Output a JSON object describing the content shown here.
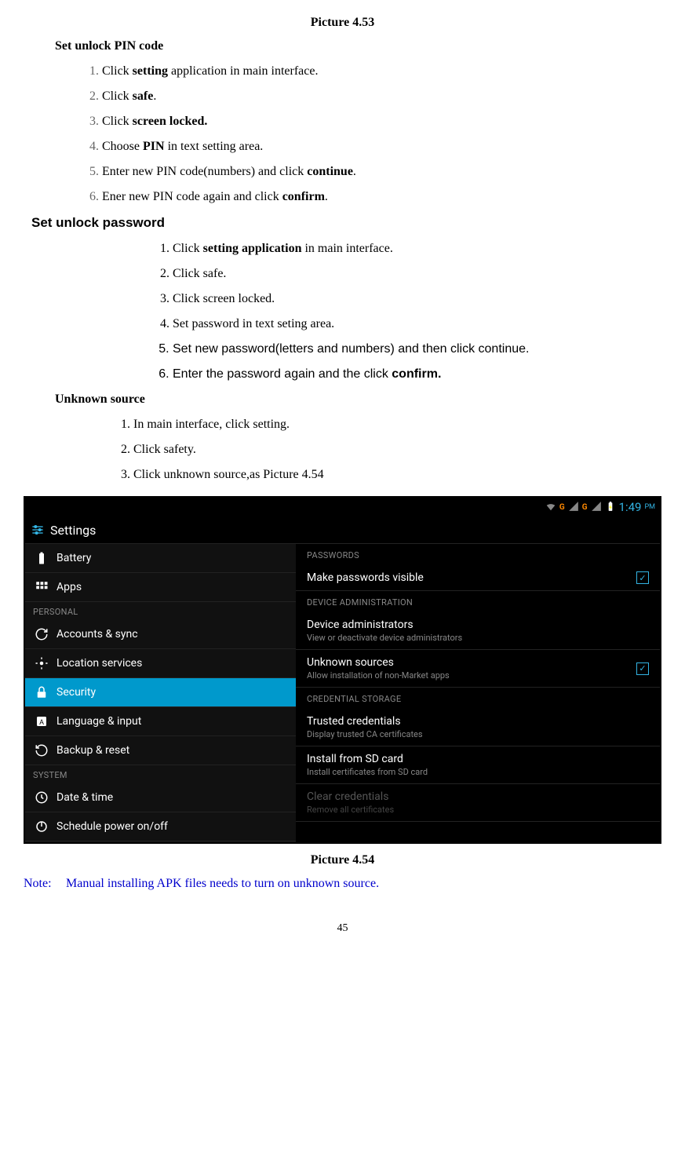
{
  "caption_top": "Picture 4.53",
  "section_pin_title": "Set unlock PIN code",
  "list_pin": [
    "Click <b>setting</b> application in main interface.",
    "Click <b>safe</b>.",
    "Click <b>screen locked.</b>",
    "Choose <b>PIN</b> in text setting area.",
    "Enter new PIN code(numbers) and click <b>continue</b>.",
    "Ener new PIN code again and click <b>confirm</b>."
  ],
  "section_password_title": "Set unlock password",
  "list_password": [
    "Click <b>setting application</b> in main interface.",
    "Click safe.",
    "Click screen locked.",
    "Set password in text seting area.",
    "Set new password(letters and numbers) and then click continue.",
    "Enter the password again and the click <b>confirm.</b>"
  ],
  "section_unknown_title": "Unknown source",
  "list_unknown": [
    "In main interface, click setting.",
    "Click safety.",
    "Click unknown source,as Picture 4.54"
  ],
  "caption_mid": "Picture 4.54",
  "note_label": "Note:",
  "note_text": "Manual installing APK files needs to turn on unknown source.",
  "page_number": "45",
  "screenshot": {
    "app_title": "Settings",
    "time": "1:49",
    "pm": "PM",
    "left": {
      "items_top": [
        {
          "icon": "battery",
          "label": "Battery"
        },
        {
          "icon": "apps",
          "label": "Apps"
        }
      ],
      "section_personal": "PERSONAL",
      "items_personal": [
        {
          "icon": "sync",
          "label": "Accounts & sync"
        },
        {
          "icon": "location",
          "label": "Location services"
        },
        {
          "icon": "lock",
          "label": "Security",
          "selected": true
        },
        {
          "icon": "lang",
          "label": "Language & input"
        },
        {
          "icon": "reset",
          "label": "Backup & reset"
        }
      ],
      "section_system": "SYSTEM",
      "items_system": [
        {
          "icon": "clock",
          "label": "Date & time"
        },
        {
          "icon": "power",
          "label": "Schedule power on/off"
        }
      ]
    },
    "right": {
      "sec_passwords": "PASSWORDS",
      "make_pw_visible": {
        "title": "Make passwords visible",
        "checked": true
      },
      "sec_device_admin": "DEVICE ADMINISTRATION",
      "device_admins": {
        "title": "Device administrators",
        "sub": "View or deactivate device administrators"
      },
      "unknown_sources": {
        "title": "Unknown sources",
        "sub": "Allow installation of non-Market apps",
        "checked": true
      },
      "sec_cred": "CREDENTIAL STORAGE",
      "trusted": {
        "title": "Trusted credentials",
        "sub": "Display trusted CA certificates"
      },
      "install_sd": {
        "title": "Install from SD card",
        "sub": "Install certificates from SD card"
      },
      "clear": {
        "title": "Clear credentials",
        "sub": "Remove all certificates",
        "disabled": true
      }
    }
  }
}
